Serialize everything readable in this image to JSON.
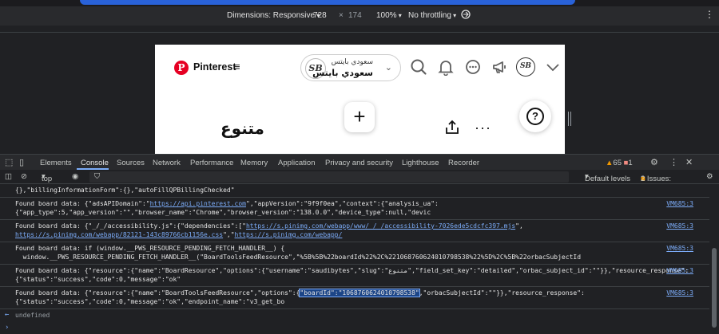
{
  "device_toolbar": {
    "dimensions_label": "Dimensions: Responsive",
    "width": "728",
    "times": "×",
    "height": "174",
    "zoom": "100%",
    "throttle": "No throttling",
    "more": "⋮"
  },
  "pinterest": {
    "logo_letter": "P",
    "brand": "Pinterest",
    "menu_icon": "≡",
    "account_avatar_text": "SB",
    "account_small_name": "سعودي بايتس",
    "account_big_name": "سعودي بايتس",
    "account_chevron": "⌄",
    "me_avatar_text": "SB",
    "board_title": "متنوع",
    "plus": "+",
    "more": "···",
    "help": "?"
  },
  "devtools": {
    "tabs": [
      "Elements",
      "Console",
      "Sources",
      "Network",
      "Performance",
      "Memory",
      "Application",
      "Privacy and security",
      "Lighthouse",
      "Recorder"
    ],
    "warnings_count": "65",
    "errors_count": "1",
    "console_toolbar": {
      "context": "top",
      "default_levels": "Default levels",
      "issues_label": "3 Issues:",
      "issues_errors": "1",
      "issues_warnings": "2"
    },
    "messages": [
      {
        "line1": "{},\"billingInformationForm\":{},\"autoFillQPBillingChecked\"",
        "line2": "",
        "source": ""
      },
      {
        "prefix": "Found board data: {\"adsAPIDomain\":\"",
        "link": "https://api.pinterest.com",
        "suffix": "\",\"appVersion\":\"9f9f0ea\",\"context\":{\"analysis_ua\":",
        "line2": "{\"app_type\":5,\"app_version\":\"\",\"browser_name\":\"Chrome\",\"browser_version\":\"138.0.0\",\"device_type\":null,\"devic",
        "source": "VM685:3"
      },
      {
        "prefix": "Found board data: {\"_/_/accessibility.js\":{\"dependencies\":[\"",
        "link": "https://s.pinimg.com/webapp/www/_/_/accessibility-7026ede5cdcfc397.mjs",
        "suffix": "\",",
        "line2_link1": "https://s.pinimg.com/webapp/82121-143c89766cb1156e.css",
        "line2_mid": "\",\"",
        "line2_link2": "https://s.pinimg.com/webapp/",
        "source": "VM685:3"
      },
      {
        "line1": "Found board data: if (window.__PWS_RESOURCE_PENDING_FETCH_HANDLER__) {",
        "line2": "  window.__PWS_RESOURCE_PENDING_FETCH_HANDLER__(\"BoardToolsFeedResource\",\"%5B%5B%22boardId%22%2C%221068760624010798538%22%5D%2C%5B%22orbacSubjectId",
        "source": "VM685:3"
      },
      {
        "line1": "Found board data: {\"resource\":{\"name\":\"BoardResource\",\"options\":{\"username\":\"saudibytes\",\"slug\":\"متنوع\",\"field_set_key\":\"detailed\",\"orbac_subject_id\":\"\"}},\"resource_response\":",
        "line2": "{\"status\":\"success\",\"code\":0,\"message\":\"ok\"",
        "source": "VM685:3"
      },
      {
        "prefix": "Found board data: {\"resource\":{\"name\":\"BoardToolsFeedResource\",\"options\":{",
        "highlight": "\"boardId\":\"1068760624010798538\"",
        "suffix": ",\"orbacSubjectId\":\"\"}},\"resource_response\":",
        "line2": "{\"status\":\"success\",\"code\":0,\"message\":\"ok\",\"endpoint_name\":\"v3_get_bo",
        "source": "VM685:3"
      }
    ],
    "result": "undefined",
    "prompt": "›",
    "result_arrow": "←"
  }
}
